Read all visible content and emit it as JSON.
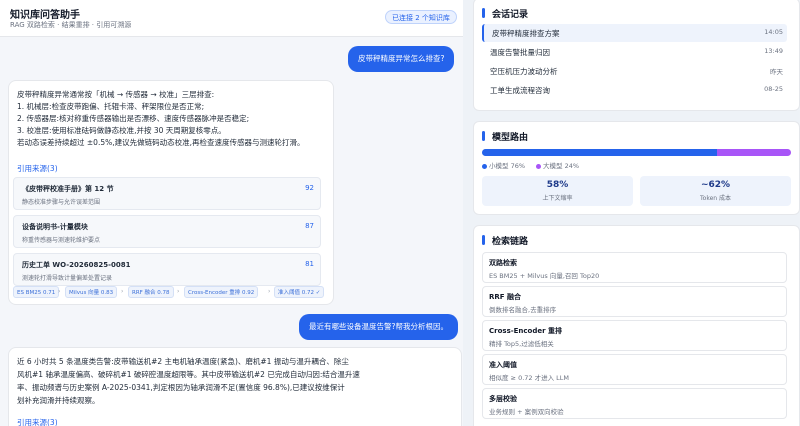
{
  "header": {
    "title": "知识库问答助手",
    "subtitle": "RAG 双路检索 · 结果重排 · 引用可溯源",
    "kb_badge": "已连接 2 个知识库"
  },
  "chat": {
    "q1": "皮带秤精度异常怎么排查?",
    "a1": {
      "lines": [
        "皮带秤精度异常通常按「机械 → 传感器 → 校准」三层排查:",
        "1. 机械层:检查皮带跑偏、托辊卡滞、秤架限位是否正常;",
        "2. 传感器层:核对称重传感器输出是否漂移、速度传感器脉冲是否稳定;",
        "3. 校准层:使用标准砝码做静态校准,并按 30 天周期复核零点。",
        "若动态误差持续超过 ±0.5%,建议先做链码动态校准,再检查速度传感器与测速轮打滑。"
      ],
      "refs_title": "引用来源(3)",
      "refs": [
        {
          "title": "《皮带秤校准手册》第 12 节",
          "desc": "静态校准步骤与允许误差范围",
          "score": "92"
        },
        {
          "title": "设备说明书-计量模块",
          "desc": "称重传感器与测速轮维护要点",
          "score": "87"
        },
        {
          "title": "历史工单 WO-20260825-0081",
          "desc": "测速轮打滑导致计量偏差处置记录",
          "score": "81"
        }
      ],
      "chips": [
        "ES BM25 0.71",
        "Milvus 向量 0.83",
        "RRF 融合 0.78",
        "Cross-Encoder 重排 0.92",
        "准入阈值 0.72 ✓"
      ]
    },
    "q2": "最近有哪些设备温度告警?帮我分析根因。",
    "a2": {
      "lines": [
        "近 6 小时共 5 条温度类告警:皮带输送机#2 主电机轴承温度(紧急)、磨机#1 振动与温升耦合、除尘",
        "风机#1 轴承温度偏高、破碎机#1 破碎腔温度超限等。其中皮带输送机#2 已完成自动归因:结合温升速",
        "率、振动频谱与历史案例 A-2025-0341,判定根因为轴承润滑不足(置信度 96.8%),已建议按维保计",
        "划补充润滑并持续观察。"
      ],
      "refs_title": "引用来源(3)"
    }
  },
  "history": {
    "title": "会话记录",
    "items": [
      {
        "label": "皮带秤精度排查方案",
        "time": "14:05",
        "active": true
      },
      {
        "label": "温度告警批量归因",
        "time": "13:49",
        "active": false
      },
      {
        "label": "空压机压力波动分析",
        "time": "昨天",
        "active": false
      },
      {
        "label": "工单生成流程咨询",
        "time": "08-25",
        "active": false
      }
    ]
  },
  "routing": {
    "title": "模型路由",
    "small_pct": 76,
    "small_label": "小模型 76%",
    "large_label": "大模型 24%",
    "colors": {
      "small": "#2563eb",
      "large": "#a855f7"
    },
    "stats": [
      {
        "value": "58%",
        "label": "上下文缩率"
      },
      {
        "value": "~62%",
        "label": "Token 成本"
      }
    ]
  },
  "pipeline": {
    "title": "检索链路",
    "steps": [
      {
        "title": "双路检索",
        "desc": "ES BM25 + Milvus 向量,召回 Top20"
      },
      {
        "title": "RRF 融合",
        "desc": "倒数排名融合,去重排序"
      },
      {
        "title": "Cross-Encoder 重排",
        "desc": "精排 Top5,过滤低相关"
      },
      {
        "title": "准入阈值",
        "desc": "相似度 ≥ 0.72 才进入 LLM"
      },
      {
        "title": "多层校验",
        "desc": "业务规则 + 案例双向校验"
      }
    ]
  }
}
